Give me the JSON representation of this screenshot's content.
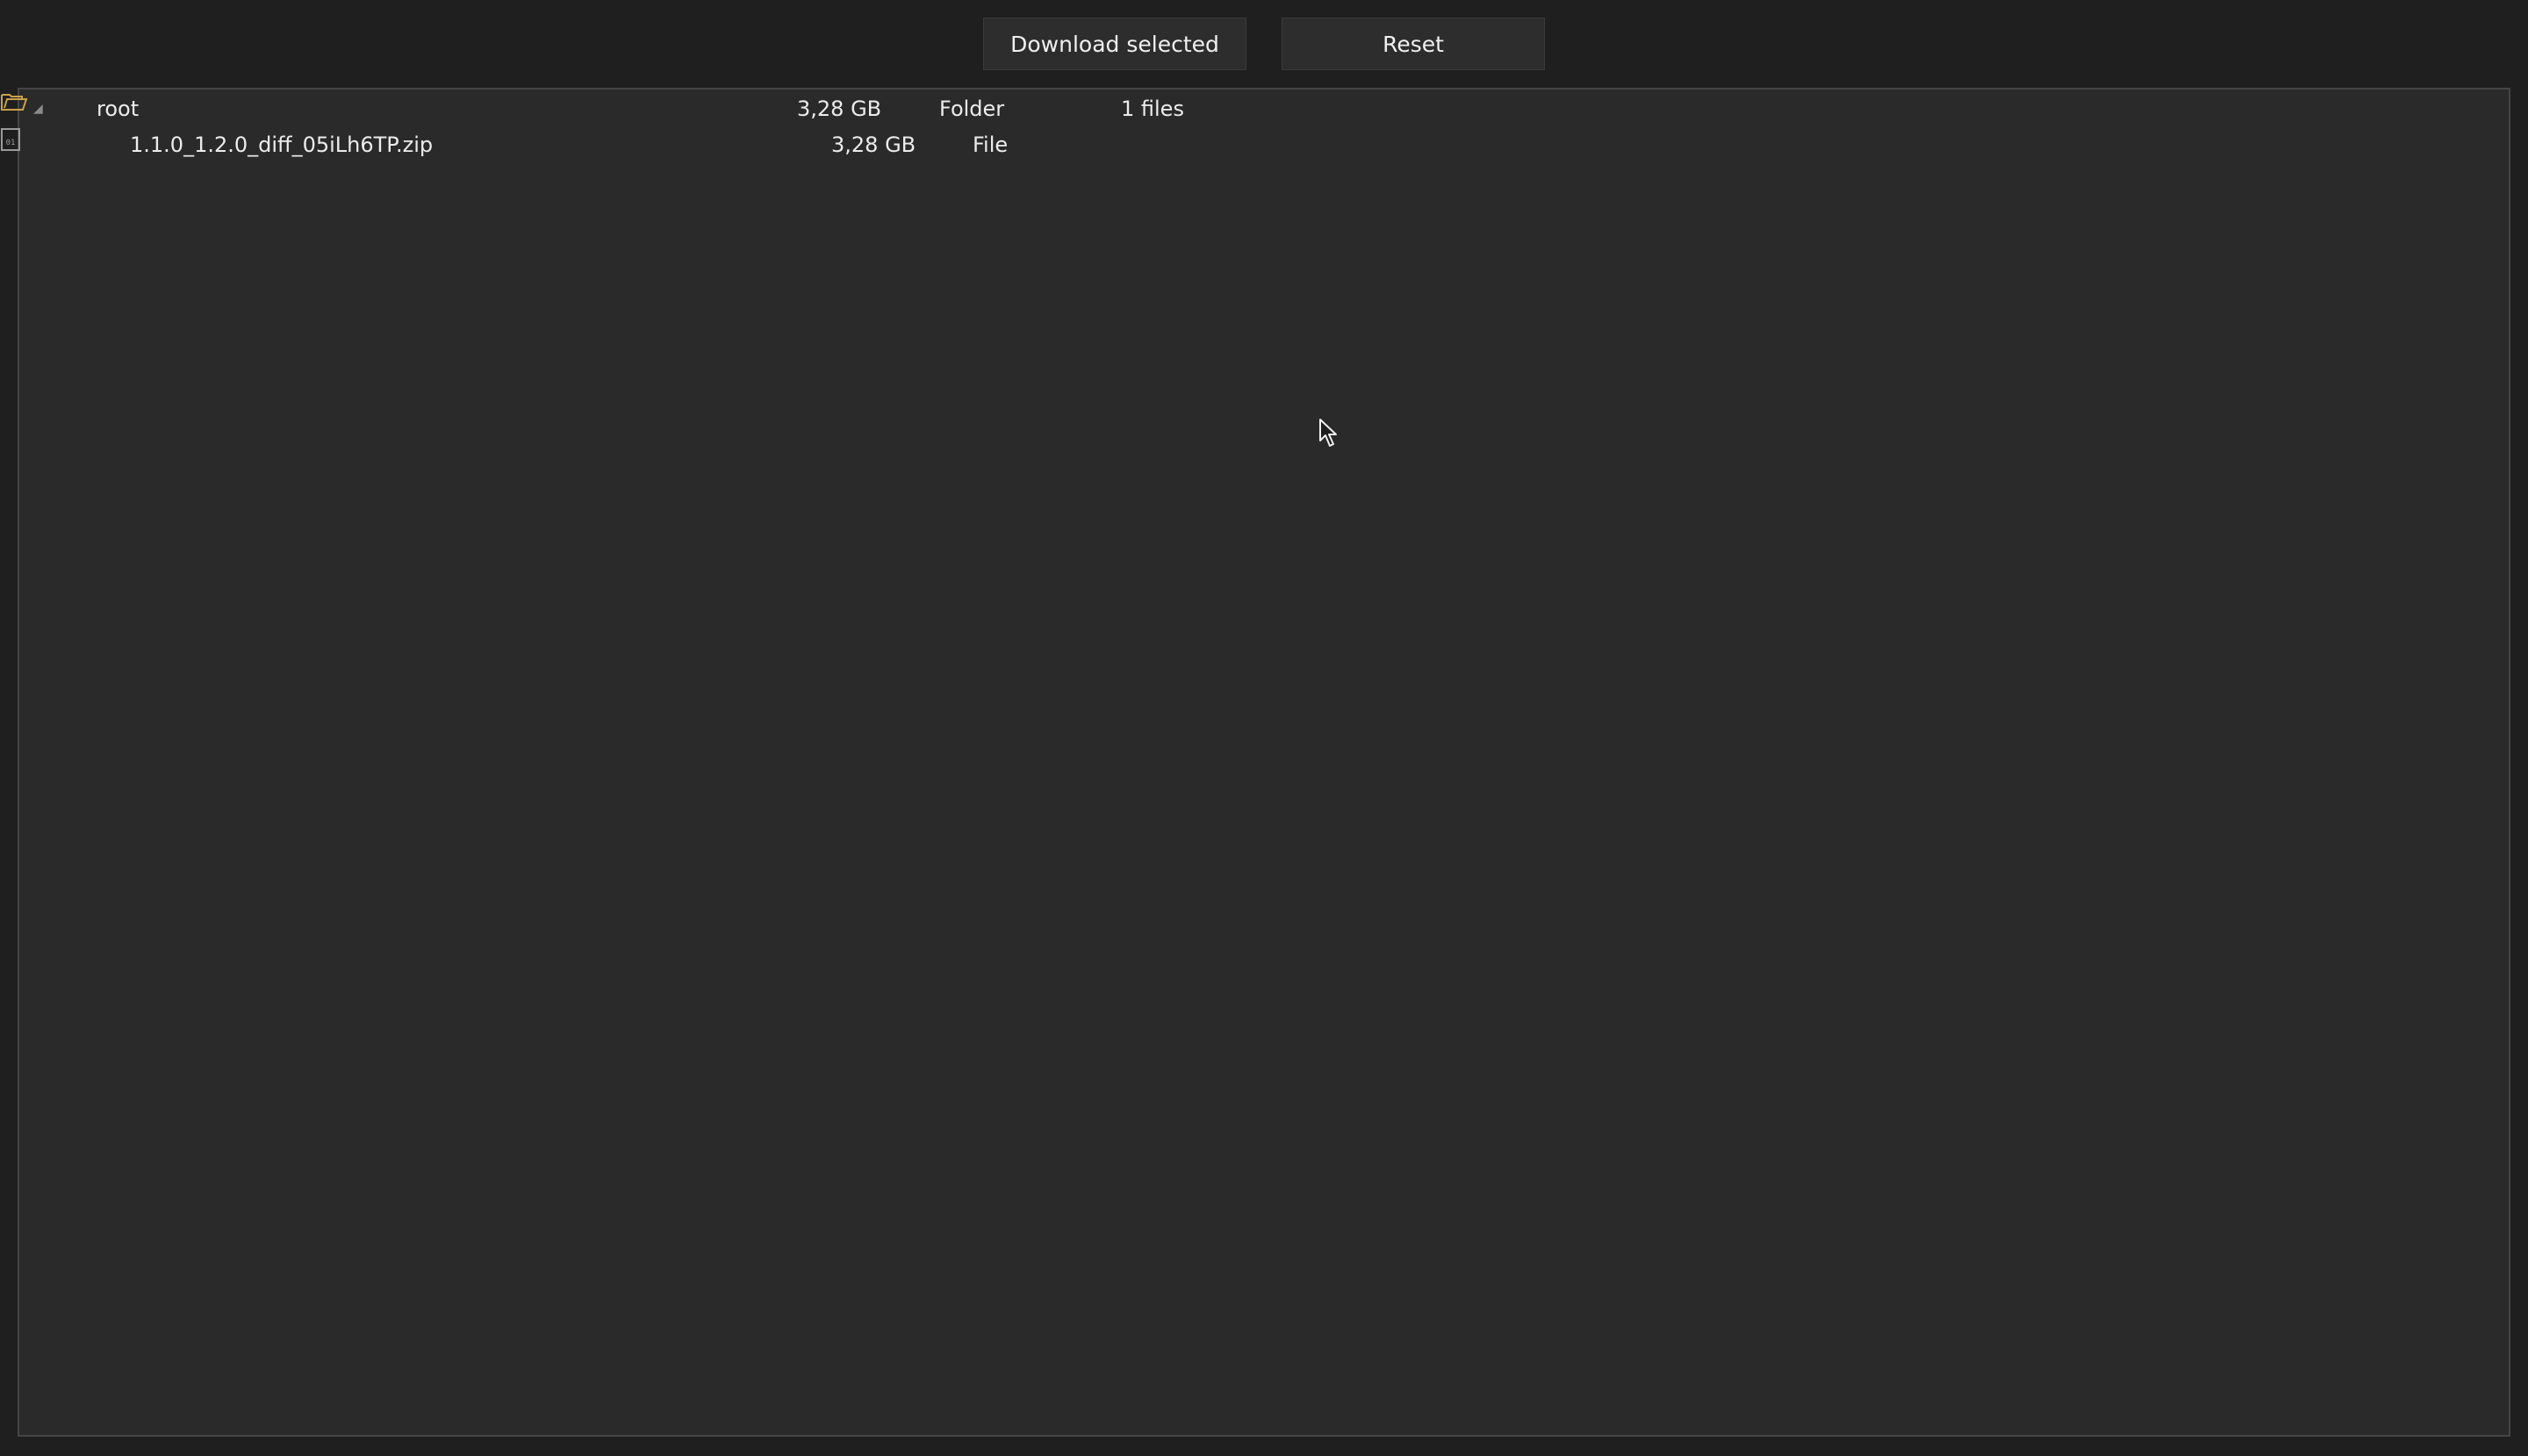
{
  "toolbar": {
    "download_label": "Download selected",
    "reset_label": "Reset"
  },
  "tree": {
    "root": {
      "name": "root",
      "size": "3,28 GB",
      "type": "Folder",
      "count": "1 files",
      "icon": "folder-open-icon"
    },
    "children": [
      {
        "name": "1.1.0_1.2.0_diff_05iLh6TP.zip",
        "size": "3,28 GB",
        "type": "File",
        "icon": "binary-file-icon"
      }
    ]
  },
  "colors": {
    "background": "#1f1f1f",
    "panel": "#2a2a2a",
    "folder": "#c8a24a",
    "text": "#ececec"
  }
}
